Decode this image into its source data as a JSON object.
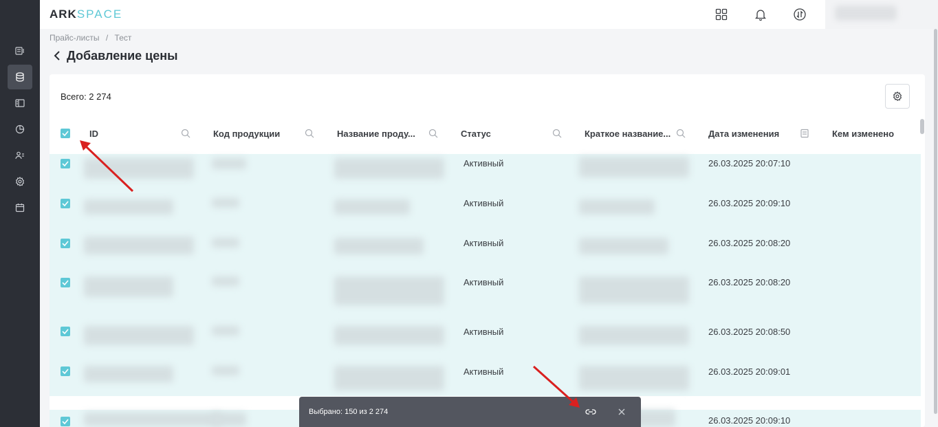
{
  "header": {
    "logo_part1": "ARK",
    "logo_part2": "SPACE"
  },
  "breadcrumb": [
    "Прайс-листы",
    "/",
    "Тест"
  ],
  "page": {
    "title": "Добавление цены"
  },
  "summary": {
    "total": "Всего: 2 274"
  },
  "table": {
    "columns": [
      "ID",
      "Код продукции",
      "Название проду...",
      "Статус",
      "Краткое название...",
      "Дата изменения",
      "Кем изменено"
    ],
    "rows": [
      {
        "status": "Активный",
        "date": "26.03.2025 20:07:10"
      },
      {
        "status": "Активный",
        "date": "26.03.2025 20:09:10"
      },
      {
        "status": "Активный",
        "date": "26.03.2025 20:08:20"
      },
      {
        "status": "Активный",
        "date": "26.03.2025 20:08:20"
      },
      {
        "status": "Активный",
        "date": "26.03.2025 20:08:50"
      },
      {
        "status": "Активный",
        "date": "26.03.2025 20:09:01"
      },
      {
        "status": "",
        "date": "26.03.2025 20:09:10"
      }
    ]
  },
  "selection": {
    "text": "Выбрано: 150 из 2 274"
  },
  "colors": {
    "accent": "#5ec8d6",
    "sidebar": "#2c2f36",
    "row_selected": "#e7f6f7",
    "selbar": "#53565f",
    "annotation_arrow": "#d9201f"
  }
}
